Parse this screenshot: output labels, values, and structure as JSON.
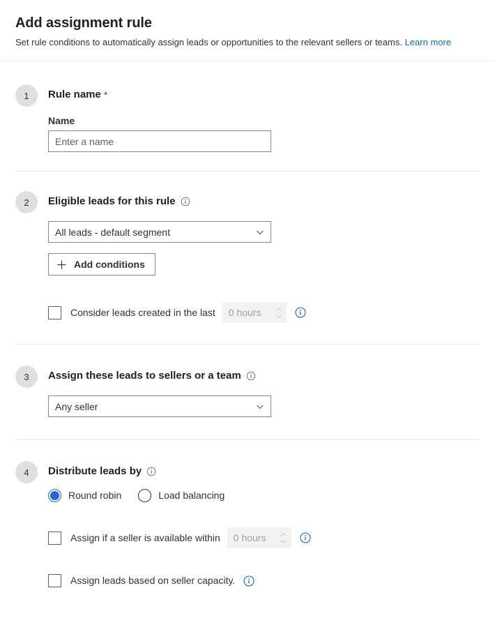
{
  "header": {
    "title": "Add assignment rule",
    "subtitle": "Set rule conditions to automatically assign leads or opportunities to the relevant sellers or teams.",
    "learn_more": "Learn more",
    "link_color": "#0f6cbd"
  },
  "colors": {
    "accent": "#2266dd",
    "info_icon": "#0f6cbd",
    "required_star": "#a4262c",
    "step_badge_bg": "#e1dfdd",
    "divider": "#ebebeb",
    "input_border": "#8a8886",
    "disabled_bg": "#f3f2f1",
    "disabled_text": "#a19f9d"
  },
  "sections": [
    {
      "number": "1",
      "title": "Rule name",
      "required": true,
      "field_label": "Name",
      "input_placeholder": "Enter a name",
      "input_value": ""
    },
    {
      "number": "2",
      "title": "Eligible leads for this rule",
      "info_icon": "info-circle-icon",
      "dropdown_value": "All leads - default segment",
      "add_conditions_label": "Add conditions",
      "add_conditions_icon": "plus-icon",
      "checkbox_label": "Consider leads created in the last",
      "checkbox_checked": false,
      "spinner_value": "0 hours",
      "spinner_disabled": true,
      "row_info_icon": "info-circle-icon"
    },
    {
      "number": "3",
      "title": "Assign these leads to sellers or a team",
      "info_icon": "info-circle-icon",
      "dropdown_value": "Any seller"
    },
    {
      "number": "4",
      "title": "Distribute leads by",
      "info_icon": "info-circle-icon",
      "radios": [
        {
          "label": "Round robin",
          "selected": true
        },
        {
          "label": "Load balancing",
          "selected": false
        }
      ],
      "checkbox_available_label": "Assign if a seller is available within",
      "checkbox_available_checked": false,
      "spinner_value": "0 hours",
      "spinner_disabled": true,
      "available_info_icon": "info-circle-icon",
      "checkbox_capacity_label": "Assign leads based on seller capacity.",
      "checkbox_capacity_checked": false,
      "capacity_info_icon": "info-circle-icon"
    }
  ]
}
